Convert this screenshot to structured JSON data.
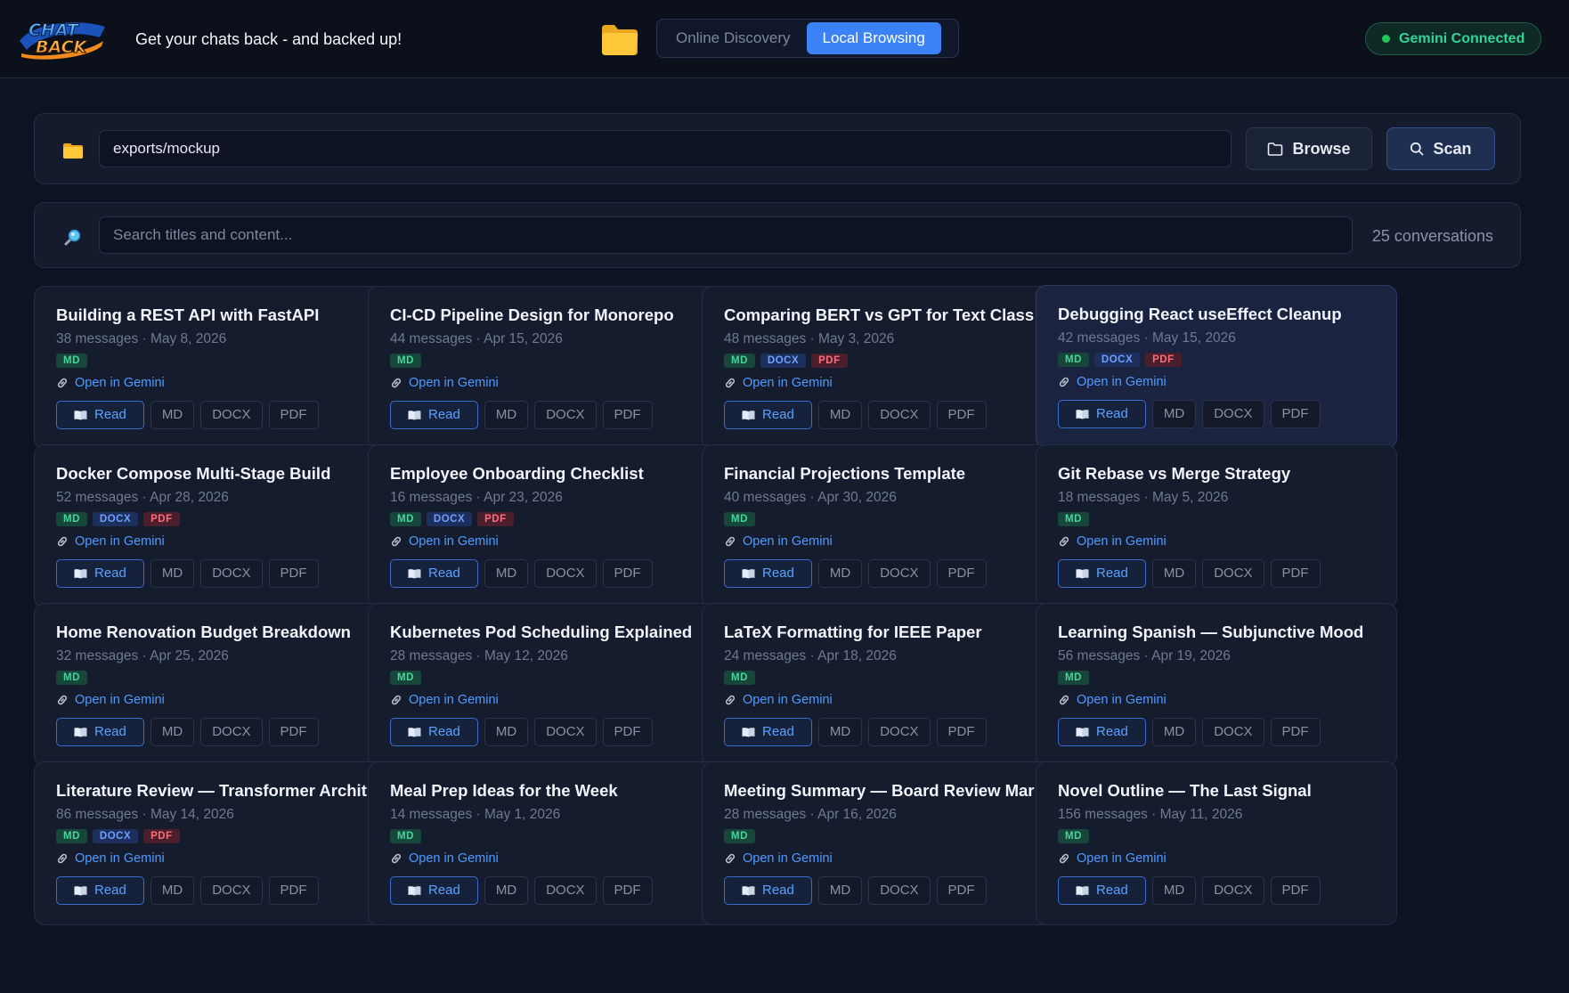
{
  "app": {
    "logo_text": "CHAT BACK",
    "tagline": "Get your chats back - and backed up!",
    "folder_icon": "folder-icon",
    "modes": [
      {
        "label": "Online Discovery",
        "active": false
      },
      {
        "label": "Local Browsing",
        "active": true
      }
    ],
    "status": {
      "label": "Gemini Connected",
      "color": "#22c55e"
    }
  },
  "path_bar": {
    "icon": "folder-icon",
    "value": "exports/mockup",
    "browse_label": "Browse",
    "browse_icon": "folder-outline-icon",
    "scan_label": "Scan",
    "scan_icon": "search-icon"
  },
  "search": {
    "icon": "magnifier-icon",
    "placeholder": "Search titles and content...",
    "count_label": "25 conversations"
  },
  "labels": {
    "open_link": "Open in Gemini",
    "read": "Read",
    "md": "MD",
    "docx": "DOCX",
    "pdf": "PDF"
  },
  "colors": {
    "accent": "#3b82f6",
    "tag_md": "#45d69a",
    "tag_docx": "#6ea0ff",
    "tag_pdf": "#ff6b7c"
  },
  "conversations": [
    {
      "title": "Building a REST API with FastAPI",
      "meta": "38 messages · May 8, 2026",
      "tags": [
        "MD"
      ],
      "highlight": false
    },
    {
      "title": "CI-CD Pipeline Design for Monorepo",
      "meta": "44 messages · Apr 15, 2026",
      "tags": [
        "MD"
      ],
      "highlight": false
    },
    {
      "title": "Comparing BERT vs GPT for Text Classif...",
      "meta": "48 messages · May 3, 2026",
      "tags": [
        "MD",
        "DOCX",
        "PDF"
      ],
      "highlight": false
    },
    {
      "title": "Debugging React useEffect Cleanup",
      "meta": "42 messages · May 15, 2026",
      "tags": [
        "MD",
        "DOCX",
        "PDF"
      ],
      "highlight": true
    },
    {
      "title": "Docker Compose Multi-Stage Build",
      "meta": "52 messages · Apr 28, 2026",
      "tags": [
        "MD",
        "DOCX",
        "PDF"
      ],
      "highlight": false
    },
    {
      "title": "Employee Onboarding Checklist",
      "meta": "16 messages · Apr 23, 2026",
      "tags": [
        "MD",
        "DOCX",
        "PDF"
      ],
      "highlight": false
    },
    {
      "title": "Financial Projections Template",
      "meta": "40 messages · Apr 30, 2026",
      "tags": [
        "MD"
      ],
      "highlight": false
    },
    {
      "title": "Git Rebase vs Merge Strategy",
      "meta": "18 messages · May 5, 2026",
      "tags": [
        "MD"
      ],
      "highlight": false
    },
    {
      "title": "Home Renovation Budget Breakdown",
      "meta": "32 messages · Apr 25, 2026",
      "tags": [
        "MD"
      ],
      "highlight": false
    },
    {
      "title": "Kubernetes Pod Scheduling Explained",
      "meta": "28 messages · May 12, 2026",
      "tags": [
        "MD"
      ],
      "highlight": false
    },
    {
      "title": "LaTeX Formatting for IEEE Paper",
      "meta": "24 messages · Apr 18, 2026",
      "tags": [
        "MD"
      ],
      "highlight": false
    },
    {
      "title": "Learning Spanish — Subjunctive Mood",
      "meta": "56 messages · Apr 19, 2026",
      "tags": [
        "MD"
      ],
      "highlight": false
    },
    {
      "title": "Literature Review — Transformer Archit...",
      "meta": "86 messages · May 14, 2026",
      "tags": [
        "MD",
        "DOCX",
        "PDF"
      ],
      "highlight": false
    },
    {
      "title": "Meal Prep Ideas for the Week",
      "meta": "14 messages · May 1, 2026",
      "tags": [
        "MD"
      ],
      "highlight": false
    },
    {
      "title": "Meeting Summary — Board Review March",
      "meta": "28 messages · Apr 16, 2026",
      "tags": [
        "MD"
      ],
      "highlight": false
    },
    {
      "title": "Novel Outline — The Last Signal",
      "meta": "156 messages · May 11, 2026",
      "tags": [
        "MD"
      ],
      "highlight": false
    }
  ]
}
